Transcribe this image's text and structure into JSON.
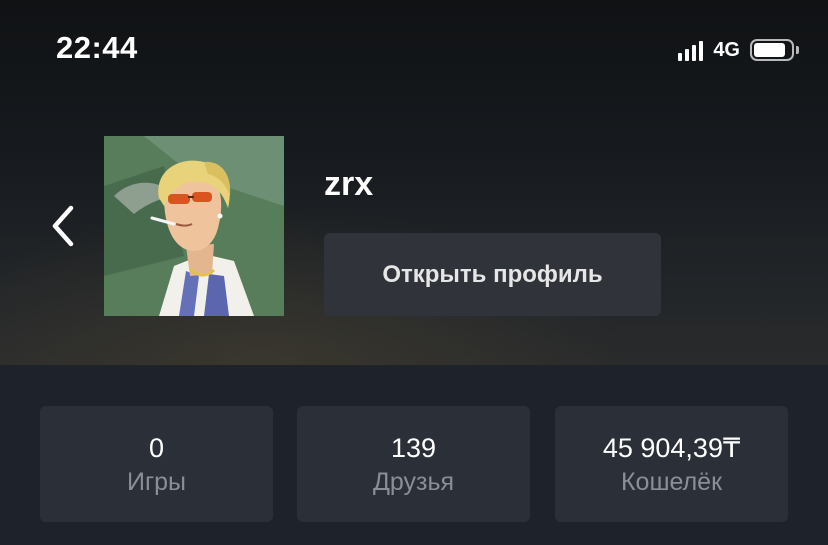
{
  "status_bar": {
    "time": "22:44",
    "network": "4G",
    "signal_bars": 4,
    "battery_level": 0.85
  },
  "profile": {
    "username": "zrx",
    "open_profile_label": "Открыть профиль",
    "back_icon": "chevron-left-icon"
  },
  "stats": [
    {
      "value": "0",
      "label": "Игры"
    },
    {
      "value": "139",
      "label": "Друзья"
    },
    {
      "value": "45 904,39₸",
      "label": "Кошелёк"
    }
  ]
}
